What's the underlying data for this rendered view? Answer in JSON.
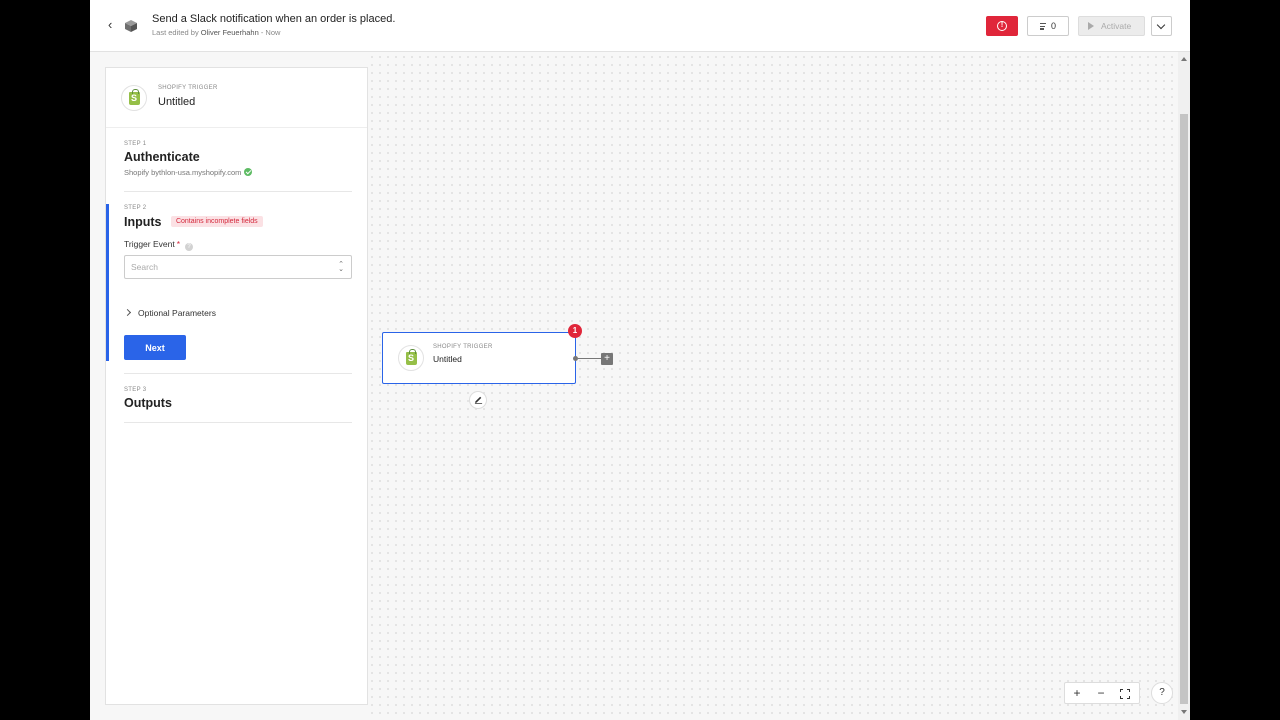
{
  "header": {
    "workflow_title": "Send a Slack notification when an order is placed.",
    "last_edited_prefix": "Last edited by",
    "editor_name": "Oliver Feuerhahn",
    "edited_when": "- Now",
    "error_icon": "alert-circle-icon",
    "log_count": "0",
    "activate_label": "Activate",
    "accent_error": "#e0263a"
  },
  "panel": {
    "trigger_label": "SHOPIFY TRIGGER",
    "trigger_title": "Untitled",
    "steps": [
      {
        "label": "STEP 1",
        "title": "Authenticate",
        "detail": "Shopify bythlon-usa.myshopify.com",
        "status": "authenticated"
      },
      {
        "label": "STEP 2",
        "title": "Inputs",
        "badge": "Contains incomplete fields",
        "field_label": "Trigger Event",
        "field_required_marker": "*",
        "search_placeholder": "Search",
        "optional_label": "Optional Parameters",
        "next_label": "Next"
      },
      {
        "label": "STEP 3",
        "title": "Outputs"
      }
    ]
  },
  "canvas": {
    "node_label": "SHOPIFY TRIGGER",
    "node_title": "Untitled",
    "node_error_count": "1",
    "add_step_symbol": "+",
    "zoom_in": "+",
    "zoom_out": "−",
    "help": "?",
    "accent_primary": "#2a64e8"
  }
}
